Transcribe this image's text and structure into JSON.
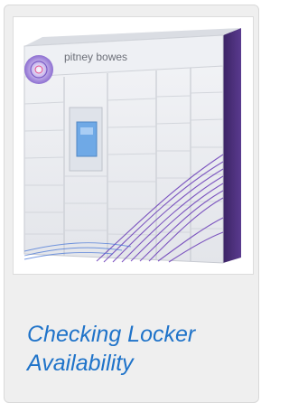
{
  "card": {
    "image_brand_text": "pitney bowes",
    "title": "Checking Locker Availability"
  },
  "colors": {
    "card_background": "#efefef",
    "title_link": "#1f73c9",
    "locker_body": "#eceef2",
    "locker_side": "#4a2f78",
    "accent_wave": "#6a3cb8",
    "screen": "#6fa9e6"
  },
  "icons": {
    "image": "parcel-locker-photo",
    "logo": "pitney-bowes-logo"
  }
}
